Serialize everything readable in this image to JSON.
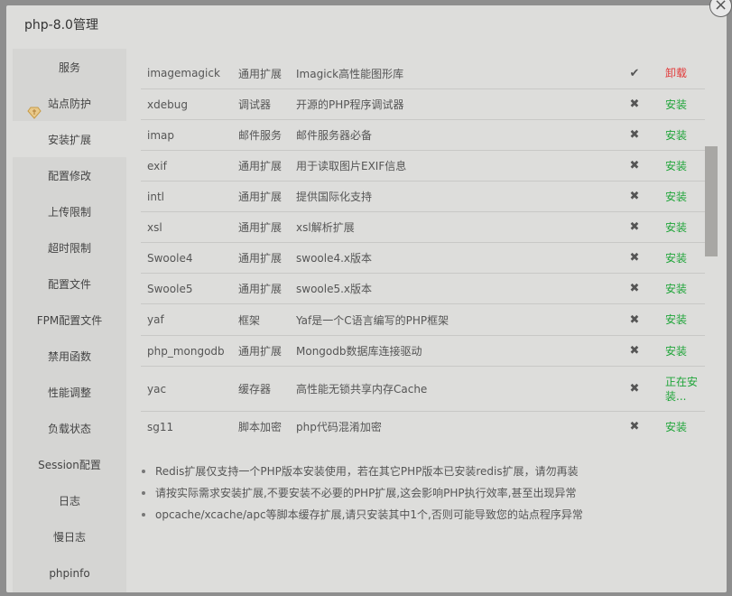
{
  "dialog": {
    "title": "php-8.0管理",
    "close_glyph": "×"
  },
  "sidebar": {
    "items": [
      {
        "label": "服务"
      },
      {
        "label": "站点防护",
        "icon": "shield-icon"
      },
      {
        "label": "安装扩展",
        "active": true
      },
      {
        "label": "配置修改"
      },
      {
        "label": "上传限制"
      },
      {
        "label": "超时限制"
      },
      {
        "label": "配置文件"
      },
      {
        "label": "FPM配置文件"
      },
      {
        "label": "禁用函数"
      },
      {
        "label": "性能调整"
      },
      {
        "label": "负载状态"
      },
      {
        "label": "Session配置"
      },
      {
        "label": "日志"
      },
      {
        "label": "慢日志"
      },
      {
        "label": "phpinfo"
      }
    ]
  },
  "extensions": {
    "rows": [
      {
        "name": "imagemagick",
        "type": "通用扩展",
        "desc": "Imagick高性能图形库",
        "status": "✔",
        "installed": true,
        "action": "卸载"
      },
      {
        "name": "xdebug",
        "type": "调试器",
        "desc": "开源的PHP程序调试器",
        "status": "✖",
        "installed": false,
        "action": "安装"
      },
      {
        "name": "imap",
        "type": "邮件服务",
        "desc": "邮件服务器必备",
        "status": "✖",
        "installed": false,
        "action": "安装"
      },
      {
        "name": "exif",
        "type": "通用扩展",
        "desc": "用于读取图片EXIF信息",
        "status": "✖",
        "installed": false,
        "action": "安装"
      },
      {
        "name": "intl",
        "type": "通用扩展",
        "desc": "提供国际化支持",
        "status": "✖",
        "installed": false,
        "action": "安装"
      },
      {
        "name": "xsl",
        "type": "通用扩展",
        "desc": "xsl解析扩展",
        "status": "✖",
        "installed": false,
        "action": "安装"
      },
      {
        "name": "Swoole4",
        "type": "通用扩展",
        "desc": "swoole4.x版本",
        "status": "✖",
        "installed": false,
        "action": "安装"
      },
      {
        "name": "Swoole5",
        "type": "通用扩展",
        "desc": "swoole5.x版本",
        "status": "✖",
        "installed": false,
        "action": "安装"
      },
      {
        "name": "yaf",
        "type": "框架",
        "desc": "Yaf是一个C语言编写的PHP框架",
        "status": "✖",
        "installed": false,
        "action": "安装"
      },
      {
        "name": "php_mongodb",
        "type": "通用扩展",
        "desc": "Mongodb数据库连接驱动",
        "status": "✖",
        "installed": false,
        "action": "安装"
      },
      {
        "name": "yac",
        "type": "缓存器",
        "desc": "高性能无锁共享内存Cache",
        "status": "✖",
        "installed": false,
        "action": "正在安装..."
      },
      {
        "name": "sg11",
        "type": "脚本加密",
        "desc": "php代码混淆加密",
        "status": "✖",
        "installed": false,
        "action": "安装"
      }
    ]
  },
  "notes": [
    "Redis扩展仅支持一个PHP版本安装使用，若在其它PHP版本已安装redis扩展，请勿再装",
    "请按实际需求安装扩展,不要安装不必要的PHP扩展,这会影响PHP执行效率,甚至出现异常",
    "opcache/xcache/apc等脚本缓存扩展,请只安装其中1个,否则可能导致您的站点程序异常"
  ],
  "colors": {
    "install": "#20a53a",
    "uninstall": "#e23b3b",
    "dialog_bg": "#dddddb",
    "sidebar_bg": "#d5d5d3"
  }
}
